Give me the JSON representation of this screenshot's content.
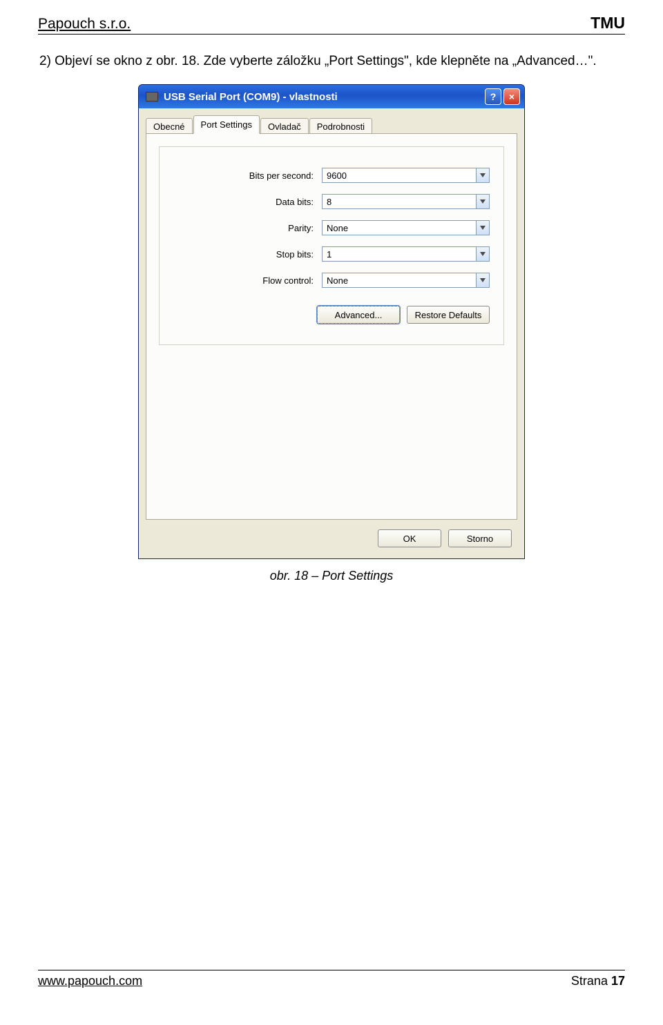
{
  "header": {
    "company": "Papouch s.r.o.",
    "doc": "TMU"
  },
  "paragraph": "2) Objeví se okno z obr. 18. Zde vyberte záložku „Port Settings\", kde klepněte na „Advanced…\".",
  "dialog": {
    "title": "USB Serial Port (COM9)  - vlastnosti",
    "tabs": [
      "Obecné",
      "Port Settings",
      "Ovladač",
      "Podrobnosti"
    ],
    "active_tab": 1,
    "fields": [
      {
        "label": "Bits per second:",
        "value": "9600"
      },
      {
        "label": "Data bits:",
        "value": "8"
      },
      {
        "label": "Parity:",
        "value": "None"
      },
      {
        "label": "Stop bits:",
        "value": "1"
      },
      {
        "label": "Flow control:",
        "value": "None"
      }
    ],
    "buttons": {
      "advanced": "Advanced...",
      "restore": "Restore Defaults"
    },
    "bottom": {
      "ok": "OK",
      "cancel": "Storno"
    }
  },
  "caption": "obr. 18 – Port Settings",
  "footer": {
    "url": "www.papouch.com",
    "page_label": "Strana ",
    "page_num": "17"
  }
}
